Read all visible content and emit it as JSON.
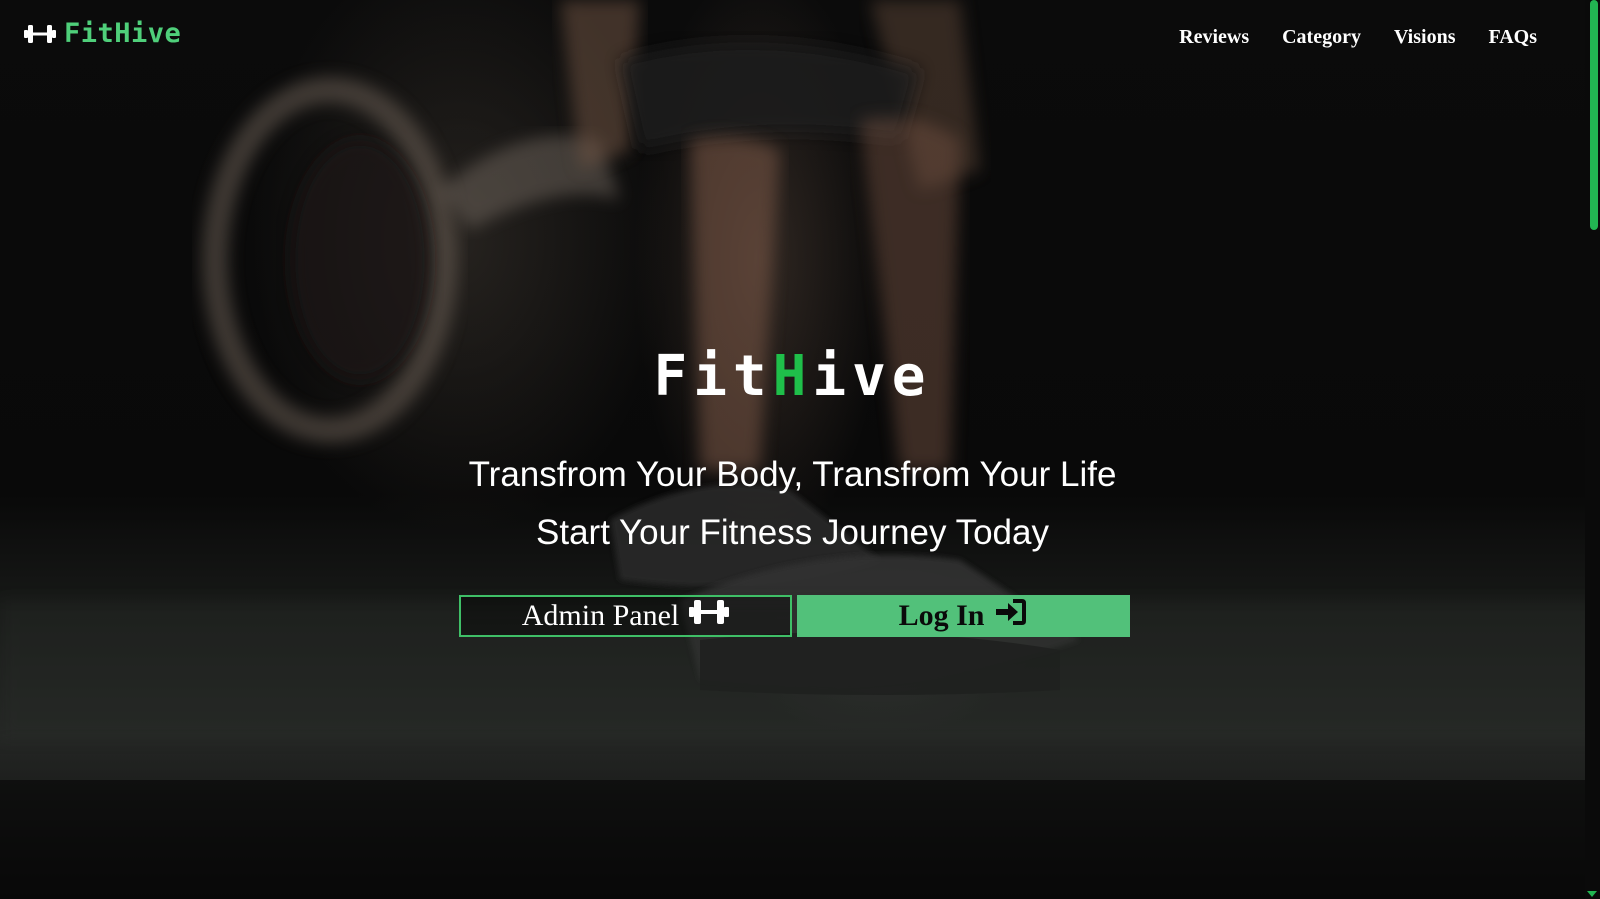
{
  "navbar": {
    "brand": "FitHive",
    "brand_icon": "dumbbell-icon",
    "links": [
      {
        "label": "Reviews"
      },
      {
        "label": "Category"
      },
      {
        "label": "Visions"
      },
      {
        "label": "FAQs"
      }
    ]
  },
  "hero": {
    "title_part1": "Fit",
    "title_accent": "H",
    "title_part2": "ive",
    "tagline_1": "Transfrom Your Body, Transfrom Your Life",
    "tagline_2": "Start Your Fitness Journey Today"
  },
  "buttons": {
    "admin_label": "Admin Panel",
    "admin_icon": "dumbbell-icon",
    "login_label": "Log In",
    "login_icon": "sign-in-icon"
  },
  "colors": {
    "accent": "#4fcf7a",
    "title_accent": "#1fbf4a",
    "login_button": "#52c17a",
    "scrollbar": "#22b552"
  }
}
